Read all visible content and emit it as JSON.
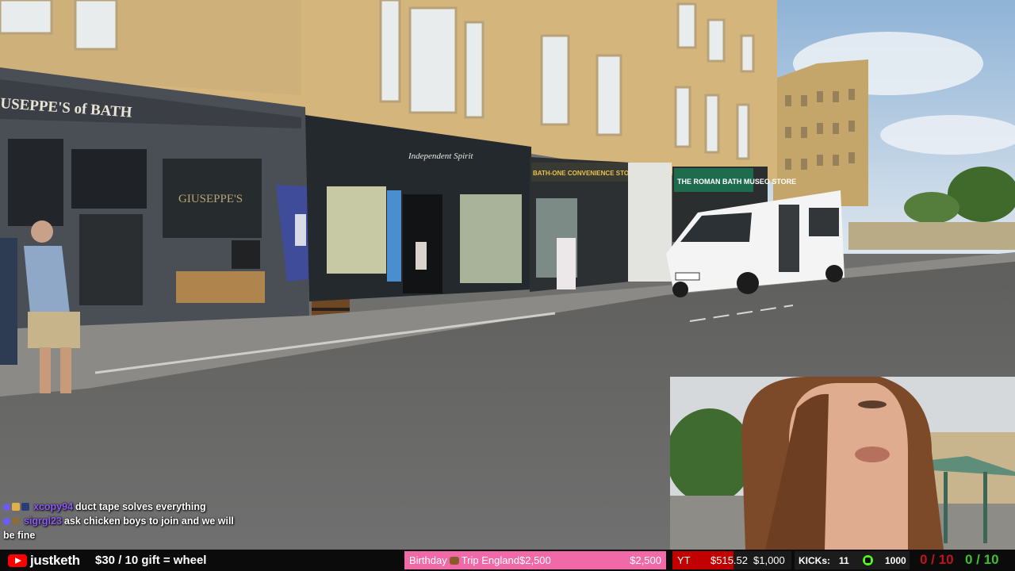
{
  "scene": {
    "sign_giuseppes": "USEPPE'S of BATH",
    "window_giuseppes": "GIUSEPPE'S",
    "sign_independent": "Independent Spirit",
    "sign_convenience": "BATH-ONE CONVENIENCE STORE & OFF LICENCE",
    "sign_roman": "THE ROMAN BATH MUSEO STORE"
  },
  "chat": {
    "messages": [
      {
        "user": "xcopy94",
        "text": "duct tape solves everything"
      },
      {
        "user": "sigrgl23",
        "text": "ask chicken boys to join and we will be fine"
      }
    ]
  },
  "ticker": {
    "channel": "justketh",
    "gift_text": "$30 / 10 gift = wheel",
    "goal_label_pre": "Birthday",
    "goal_label_post": "Trip England",
    "goal_amount": "$2,500",
    "goal_total": "$2,500",
    "yt_label": "YT",
    "yt_amount": "$515.52",
    "yt_target": "$1,000",
    "yt_progress": 0.5155,
    "kicks_label": "KICKs:",
    "kicks_count": "11",
    "kicks_goal": "1000",
    "counter_red": "0 / 10",
    "counter_green": "0 / 10",
    "colors": {
      "goal": "#f06aa8",
      "yt": "#c20000",
      "kick": "#53fc18",
      "red": "#c0141b",
      "green": "#3fbf2f"
    }
  }
}
